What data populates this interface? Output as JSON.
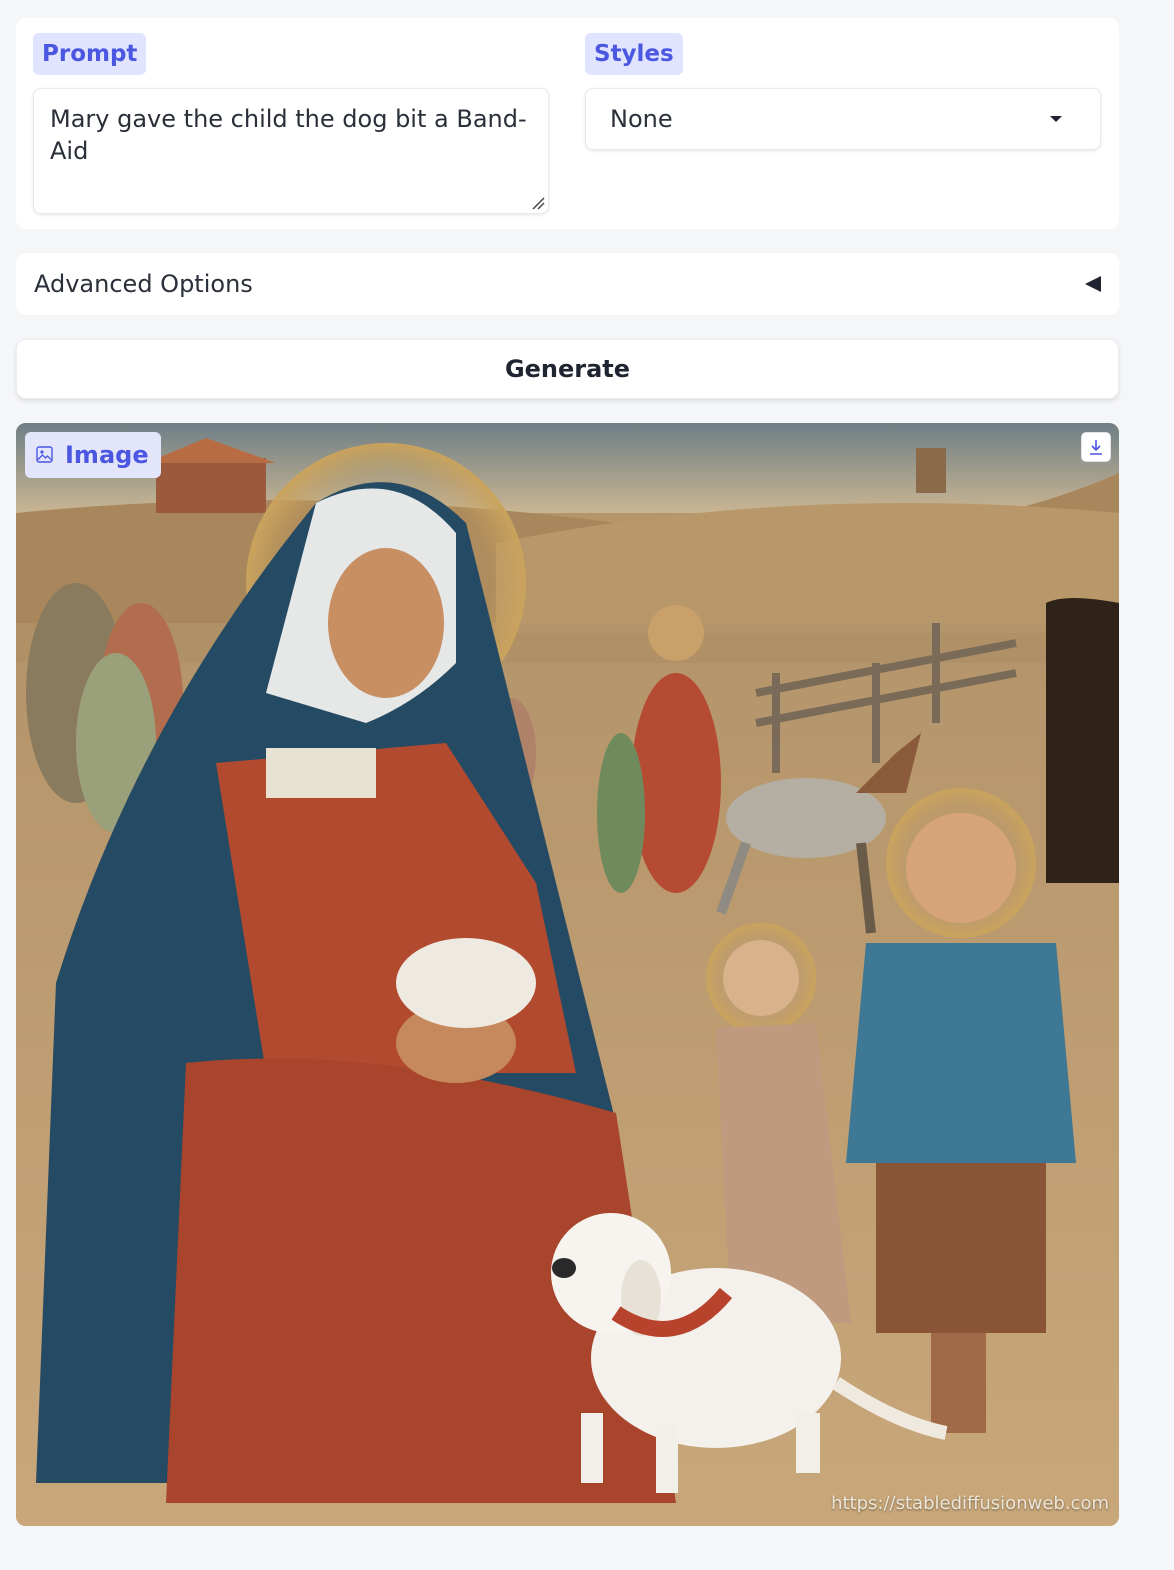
{
  "prompt": {
    "label": "Prompt",
    "value": "Mary gave the child the dog bit a Band-Aid"
  },
  "styles": {
    "label": "Styles",
    "selected": "None"
  },
  "advanced": {
    "label": "Advanced Options"
  },
  "generate": {
    "label": "Generate"
  },
  "output": {
    "label": "Image",
    "watermark": "https://stablediffusionweb.com",
    "accent": "#4b57e0"
  }
}
